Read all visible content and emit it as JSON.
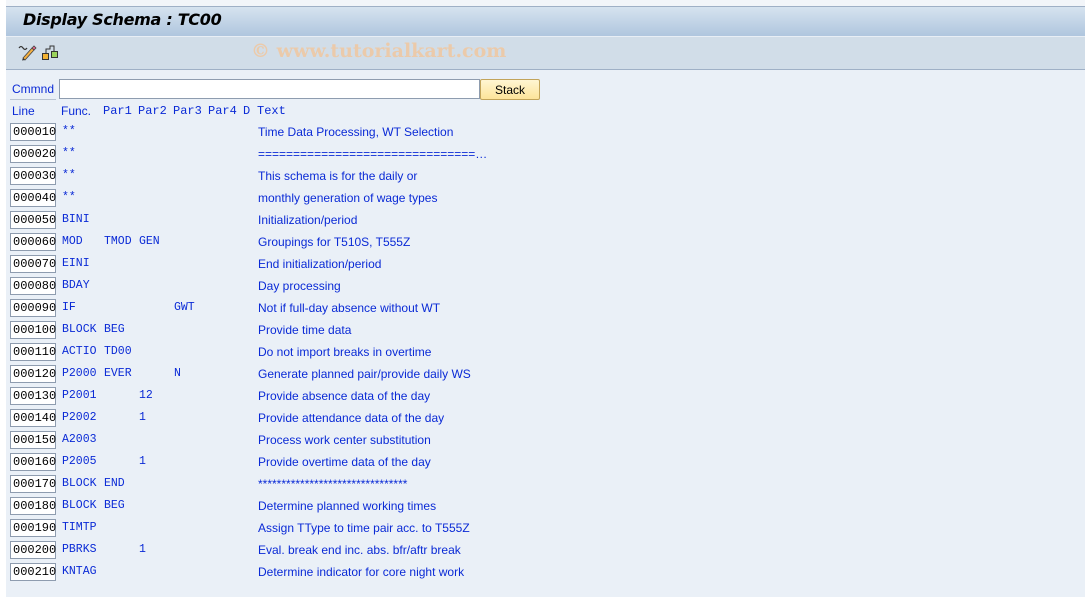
{
  "window": {
    "title": "Display Schema : TC00",
    "watermark": "© www.tutorialkart.com"
  },
  "toolbar": {
    "icons": [
      {
        "name": "display-change-icon",
        "tooltip": ""
      },
      {
        "name": "structure-hierarchy-icon",
        "tooltip": ""
      }
    ]
  },
  "command": {
    "label": "Cmmnd",
    "value": "",
    "placeholder": "",
    "stack_label": "Stack"
  },
  "columns": {
    "line": "Line",
    "func": "Func.",
    "par1": "Par1",
    "par2": "Par2",
    "par3": "Par3",
    "par4": "Par4",
    "d": "D",
    "text": "Text"
  },
  "rows": [
    {
      "line": "000010",
      "func": "**",
      "par1": "",
      "par2": "",
      "par3": "",
      "par4": "",
      "d": "",
      "text": "Time Data Processing, WT Selection"
    },
    {
      "line": "000020",
      "func": "**",
      "par1": "",
      "par2": "",
      "par3": "",
      "par4": "",
      "d": "",
      "text": "===============================…"
    },
    {
      "line": "000030",
      "func": "**",
      "par1": "",
      "par2": "",
      "par3": "",
      "par4": "",
      "d": "",
      "text": "This schema is for the daily or"
    },
    {
      "line": "000040",
      "func": "**",
      "par1": "",
      "par2": "",
      "par3": "",
      "par4": "",
      "d": "",
      "text": "monthly generation of wage types"
    },
    {
      "line": "000050",
      "func": "BINI",
      "par1": "",
      "par2": "",
      "par3": "",
      "par4": "",
      "d": "",
      "text": "Initialization/period"
    },
    {
      "line": "000060",
      "func": "MOD",
      "par1": "TMOD",
      "par2": "GEN",
      "par3": "",
      "par4": "",
      "d": "",
      "text": "Groupings for T510S, T555Z"
    },
    {
      "line": "000070",
      "func": "EINI",
      "par1": "",
      "par2": "",
      "par3": "",
      "par4": "",
      "d": "",
      "text": "End initialization/period"
    },
    {
      "line": "000080",
      "func": "BDAY",
      "par1": "",
      "par2": "",
      "par3": "",
      "par4": "",
      "d": "",
      "text": "Day processing"
    },
    {
      "line": "000090",
      "func": "IF",
      "par1": "",
      "par2": "",
      "par3": "GWT",
      "par4": "",
      "d": "",
      "text": "Not if full-day absence without WT"
    },
    {
      "line": "000100",
      "func": "BLOCK",
      "par1": "BEG",
      "par2": "",
      "par3": "",
      "par4": "",
      "d": "",
      "text": "Provide time data"
    },
    {
      "line": "000110",
      "func": "ACTIO",
      "par1": "TD00",
      "par2": "",
      "par3": "",
      "par4": "",
      "d": "",
      "text": "Do not import breaks in overtime"
    },
    {
      "line": "000120",
      "func": "P2000",
      "par1": "EVER",
      "par2": "",
      "par3": "N",
      "par4": "",
      "d": "",
      "text": "Generate planned pair/provide daily WS"
    },
    {
      "line": "000130",
      "func": "P2001",
      "par1": "",
      "par2": "12",
      "par3": "",
      "par4": "",
      "d": "",
      "text": "Provide absence data of the day"
    },
    {
      "line": "000140",
      "func": "P2002",
      "par1": "",
      "par2": "1",
      "par3": "",
      "par4": "",
      "d": "",
      "text": "Provide attendance data of the day"
    },
    {
      "line": "000150",
      "func": "A2003",
      "par1": "",
      "par2": "",
      "par3": "",
      "par4": "",
      "d": "",
      "text": "Process work center substitution"
    },
    {
      "line": "000160",
      "func": "P2005",
      "par1": "",
      "par2": "1",
      "par3": "",
      "par4": "",
      "d": "",
      "text": "Provide overtime data of the day"
    },
    {
      "line": "000170",
      "func": "BLOCK",
      "par1": "END",
      "par2": "",
      "par3": "",
      "par4": "",
      "d": "",
      "text": "********************************"
    },
    {
      "line": "000180",
      "func": "BLOCK",
      "par1": "BEG",
      "par2": "",
      "par3": "",
      "par4": "",
      "d": "",
      "text": "Determine planned working times"
    },
    {
      "line": "000190",
      "func": "TIMTP",
      "par1": "",
      "par2": "",
      "par3": "",
      "par4": "",
      "d": "",
      "text": "Assign TType to time pair acc. to T555Z"
    },
    {
      "line": "000200",
      "func": "PBRKS",
      "par1": "",
      "par2": "1",
      "par3": "",
      "par4": "",
      "d": "",
      "text": "Eval. break end inc. abs. bfr/aftr break"
    },
    {
      "line": "000210",
      "func": "KNTAG",
      "par1": "",
      "par2": "",
      "par3": "",
      "par4": "",
      "d": "",
      "text": "Determine indicator for core night work"
    }
  ]
}
